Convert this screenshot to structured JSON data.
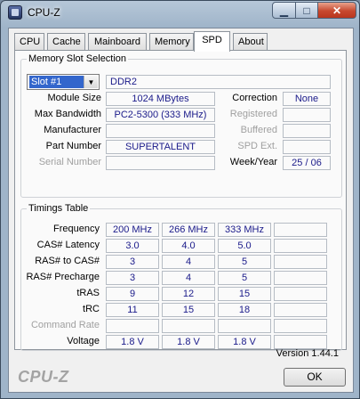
{
  "window": {
    "title": "CPU-Z"
  },
  "controls": {
    "minimize": "▁",
    "maximize": "□",
    "close": "✕"
  },
  "tabs": [
    {
      "label": "CPU"
    },
    {
      "label": "Cache"
    },
    {
      "label": "Mainboard"
    },
    {
      "label": "Memory"
    },
    {
      "label": "SPD"
    },
    {
      "label": "About"
    }
  ],
  "active_tab": "SPD",
  "slot": {
    "group_title": "Memory Slot Selection",
    "selected": "Slot #1",
    "type": "DDR2",
    "module_size_label": "Module Size",
    "module_size": "1024 MBytes",
    "max_bandwidth_label": "Max Bandwidth",
    "max_bandwidth": "PC2-5300 (333 MHz)",
    "manufacturer_label": "Manufacturer",
    "manufacturer": "",
    "part_number_label": "Part Number",
    "part_number": "SUPERTALENT",
    "serial_number_label": "Serial Number",
    "serial_number": "",
    "correction_label": "Correction",
    "correction": "None",
    "registered_label": "Registered",
    "registered": "",
    "buffered_label": "Buffered",
    "buffered": "",
    "spd_ext_label": "SPD Ext.",
    "spd_ext": "",
    "week_year_label": "Week/Year",
    "week_year": "25 / 06"
  },
  "timings": {
    "group_title": "Timings Table",
    "rows": [
      {
        "label": "Frequency",
        "values": [
          "200 MHz",
          "266 MHz",
          "333 MHz",
          ""
        ]
      },
      {
        "label": "CAS# Latency",
        "values": [
          "3.0",
          "4.0",
          "5.0",
          ""
        ]
      },
      {
        "label": "RAS# to CAS#",
        "values": [
          "3",
          "4",
          "5",
          ""
        ]
      },
      {
        "label": "RAS# Precharge",
        "values": [
          "3",
          "4",
          "5",
          ""
        ]
      },
      {
        "label": "tRAS",
        "values": [
          "9",
          "12",
          "15",
          ""
        ]
      },
      {
        "label": "tRC",
        "values": [
          "11",
          "15",
          "18",
          ""
        ]
      },
      {
        "label": "Command Rate",
        "values": [
          "",
          "",
          "",
          ""
        ]
      },
      {
        "label": "Voltage",
        "values": [
          "1.8 V",
          "1.8 V",
          "1.8 V",
          ""
        ]
      }
    ]
  },
  "footer": {
    "version": "Version 1.44.1",
    "logo": "CPU-Z",
    "ok_label": "OK"
  }
}
